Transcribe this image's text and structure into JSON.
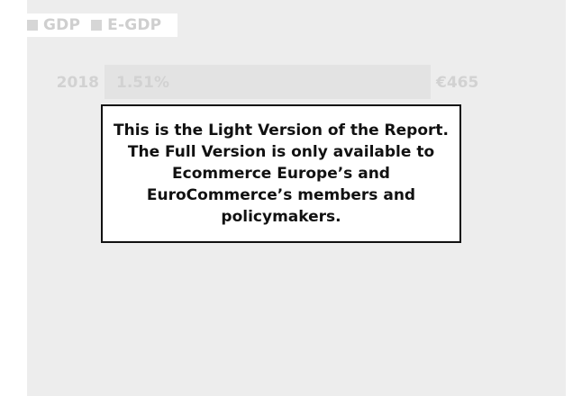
{
  "colors": {
    "panel_bg": "#ededed",
    "legend_gdp": "#d6d6d6",
    "legend_egdp": "#d6d6d6",
    "bar_fill": "#e3e3e3",
    "label_color": "#d2d2d2",
    "overlay_border": "#111111",
    "overlay_text": "#111111"
  },
  "legend": {
    "items": [
      {
        "label": "GDP"
      },
      {
        "label": "E-GDP"
      }
    ]
  },
  "overlay": {
    "message": "This is the Light Version of the Report. The Full Version is only available to Ecommerce Europe’s and EuroCommerce’s members and policymakers."
  },
  "chart_data": {
    "type": "bar",
    "orientation": "horizontal",
    "title": "",
    "xlabel": "",
    "ylabel": "",
    "categories": [
      "2018"
    ],
    "series": [
      {
        "name": "E-GDP",
        "values": [
          1.51
        ],
        "value_labels": [
          "1.51%"
        ]
      },
      {
        "name": "GDP",
        "values": [
          465
        ],
        "value_labels": [
          "€465"
        ]
      }
    ],
    "grid": false,
    "legend_position": "top-left"
  }
}
